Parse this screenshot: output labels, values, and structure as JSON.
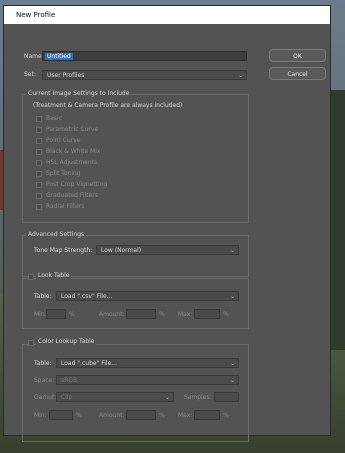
{
  "window": {
    "title": "New Profile"
  },
  "form": {
    "name_label": "Name:",
    "name_value": "Untitled",
    "set_label": "Set:",
    "set_value": "User Profiles"
  },
  "buttons": {
    "ok": "OK",
    "cancel": "Cancel"
  },
  "current_settings": {
    "title": "Current Image Settings to Include",
    "subtitle": "(Treatment & Camera Profile are always included)",
    "items": [
      {
        "label": "Basic"
      },
      {
        "label": "Parametric Curve"
      },
      {
        "label": "Point Curve"
      },
      {
        "label": "Black & White Mix"
      },
      {
        "label": "HSL Adjustments"
      },
      {
        "label": "Split Toning"
      },
      {
        "label": "Post Crop Vignetting"
      },
      {
        "label": "Graduated Filters"
      },
      {
        "label": "Radial Filters"
      }
    ]
  },
  "advanced": {
    "title": "Advanced Settings",
    "tone_map_label": "Tone Map Strength:",
    "tone_map_value": "Low (Normal)"
  },
  "look_table": {
    "title": "Look Table",
    "table_label": "Table:",
    "table_value": "Load \".csv\" File...",
    "min_label": "Min:",
    "amount_label": "Amount:",
    "max_label": "Max:",
    "percent": "%"
  },
  "color_lookup": {
    "title": "Color Lookup Table",
    "table_label": "Table:",
    "table_value": "Load \".cube\" File...",
    "space_label": "Space:",
    "space_value": "sRGB",
    "gamut_label": "Gamut:",
    "gamut_value": "Clip",
    "samples_label": "Samples:",
    "min_label": "Min:",
    "amount_label": "Amount:",
    "max_label": "Max:",
    "percent": "%"
  }
}
